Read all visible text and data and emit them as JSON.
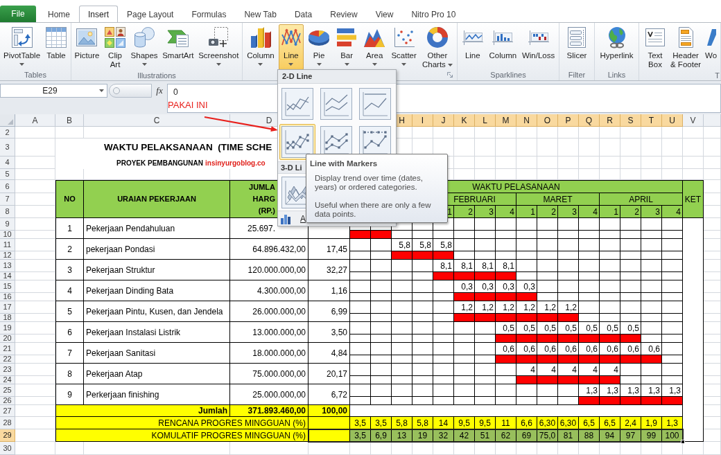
{
  "tabs": {
    "file": "File",
    "items": [
      {
        "label": "Home",
        "selected": false
      },
      {
        "label": "Insert",
        "selected": true
      },
      {
        "label": "Page Layout",
        "selected": false
      },
      {
        "label": "Formulas",
        "selected": false
      },
      {
        "label": "New Tab",
        "selected": false
      },
      {
        "label": "Data",
        "selected": false
      },
      {
        "label": "Review",
        "selected": false
      },
      {
        "label": "View",
        "selected": false
      },
      {
        "label": "Nitro Pro 10",
        "selected": false
      }
    ]
  },
  "ribbon": {
    "groups": [
      {
        "label": "Tables",
        "launcher": false,
        "items": [
          {
            "kind": "pivot",
            "label": [
              "PivotTable"
            ],
            "menu": true
          },
          {
            "kind": "table",
            "label": [
              "Table"
            ],
            "menu": false
          }
        ]
      },
      {
        "label": "Illustrations",
        "launcher": false,
        "items": [
          {
            "kind": "picture",
            "label": [
              "Picture"
            ],
            "menu": false
          },
          {
            "kind": "clipart",
            "label": [
              "Clip",
              "Art"
            ],
            "menu": false
          },
          {
            "kind": "shapes",
            "label": [
              "Shapes"
            ],
            "menu": true
          },
          {
            "kind": "smartart",
            "label": [
              "SmartArt"
            ],
            "menu": false
          },
          {
            "kind": "screenshot",
            "label": [
              "Screenshot"
            ],
            "menu": true
          }
        ]
      },
      {
        "launcher": true,
        "items": [
          {
            "kind": "column",
            "label": [
              "Column"
            ],
            "menu": true,
            "pressed": false
          },
          {
            "kind": "line",
            "label": [
              "Line"
            ],
            "menu": true,
            "pressed": true
          },
          {
            "kind": "pie",
            "label": [
              "Pie"
            ],
            "menu": true,
            "pressed": false
          },
          {
            "kind": "bar",
            "label": [
              "Bar"
            ],
            "menu": true,
            "pressed": false
          },
          {
            "kind": "area",
            "label": [
              "Area"
            ],
            "menu": true,
            "pressed": false
          },
          {
            "kind": "scatter",
            "label": [
              "Scatter"
            ],
            "menu": true,
            "pressed": false
          },
          {
            "kind": "other",
            "label": [
              "Other",
              "Charts"
            ],
            "menu": true,
            "pressed": false
          }
        ]
      },
      {
        "label": "Sparklines",
        "launcher": false,
        "items": [
          {
            "kind": "sparkline",
            "label": [
              "Line"
            ],
            "menu": false
          },
          {
            "kind": "sparkcolumn",
            "label": [
              "Column"
            ],
            "menu": false
          },
          {
            "kind": "winloss",
            "label": [
              "Win/Loss"
            ],
            "menu": false
          }
        ]
      },
      {
        "label": "Filter",
        "launcher": false,
        "items": [
          {
            "kind": "slicer",
            "label": [
              "Slicer"
            ],
            "menu": false
          }
        ]
      },
      {
        "label": "Links",
        "launcher": false,
        "items": [
          {
            "kind": "hyperlink",
            "label": [
              "Hyperlink"
            ],
            "menu": false
          }
        ]
      },
      {
        "label": "T",
        "launcher": false,
        "items": [
          {
            "kind": "textbox",
            "label": [
              "Text",
              "Box"
            ],
            "menu": false
          },
          {
            "kind": "header",
            "label": [
              "Header",
              "& Footer"
            ],
            "menu": false
          },
          {
            "kind": "wordart",
            "label": [
              "Wo"
            ],
            "menu": false
          }
        ]
      }
    ]
  },
  "formula_bar": {
    "name_box": "E29",
    "function_button": "fx",
    "value": "0"
  },
  "annotation": "PAKAI INI",
  "column_headers_left": [
    {
      "label": "A",
      "selected": false
    },
    {
      "label": "B",
      "selected": false
    },
    {
      "label": "C",
      "selected": false
    },
    {
      "label": "D",
      "selected": false
    }
  ],
  "column_headers_right": [
    {
      "label": "H",
      "selected": true
    },
    {
      "label": "I",
      "selected": true
    },
    {
      "label": "J",
      "selected": true
    },
    {
      "label": "K",
      "selected": true
    },
    {
      "label": "L",
      "selected": true
    },
    {
      "label": "M",
      "selected": true
    },
    {
      "label": "N",
      "selected": true
    },
    {
      "label": "O",
      "selected": true
    },
    {
      "label": "P",
      "selected": true
    },
    {
      "label": "Q",
      "selected": true
    },
    {
      "label": "R",
      "selected": true
    },
    {
      "label": "S",
      "selected": true
    },
    {
      "label": "T",
      "selected": true
    },
    {
      "label": "U",
      "selected": true
    },
    {
      "label": "V",
      "selected": false
    }
  ],
  "row_headers": [
    {
      "label": "2",
      "selected": false
    },
    {
      "label": "3",
      "selected": false
    },
    {
      "label": "4",
      "selected": false
    },
    {
      "label": "5",
      "selected": false
    },
    {
      "label": "6",
      "selected": false
    },
    {
      "label": "7",
      "selected": false
    },
    {
      "label": "8",
      "selected": false
    },
    {
      "label": "9",
      "selected": false
    },
    {
      "label": "10",
      "selected": false
    },
    {
      "label": "11",
      "selected": false
    },
    {
      "label": "12",
      "selected": false
    },
    {
      "label": "13",
      "selected": false
    },
    {
      "label": "14",
      "selected": false
    },
    {
      "label": "15",
      "selected": false
    },
    {
      "label": "16",
      "selected": false
    },
    {
      "label": "17",
      "selected": false
    },
    {
      "label": "18",
      "selected": false
    },
    {
      "label": "19",
      "selected": false
    },
    {
      "label": "20",
      "selected": false
    },
    {
      "label": "21",
      "selected": false
    },
    {
      "label": "22",
      "selected": false
    },
    {
      "label": "23",
      "selected": false
    },
    {
      "label": "24",
      "selected": false
    },
    {
      "label": "25",
      "selected": false
    },
    {
      "label": "26",
      "selected": false
    },
    {
      "label": "27",
      "selected": false
    },
    {
      "label": "28",
      "selected": false
    },
    {
      "label": "29",
      "selected": true
    },
    {
      "label": "30",
      "selected": false
    }
  ],
  "sheet": {
    "title": "WAKTU PELAKSANAAN  (TIME SCHE",
    "subtitle": "PROYEK PEMBANGUNAN",
    "website": "insinyurgoblog.co",
    "table": {
      "headers": {
        "no": "NO",
        "description": "URAIAN PEKERJAAN",
        "amount": [
          "JUMLA",
          "HARG",
          "(RP.)"
        ],
        "schedule": "WAKTU PELASANAAN",
        "months": [
          "FEBRUARI",
          "MARET",
          "APRIL"
        ],
        "weeks": [
          "1",
          "2",
          "3",
          "4",
          "1",
          "2",
          "3",
          "4",
          "1",
          "2",
          "3",
          "4"
        ],
        "notes": "KET"
      },
      "rows": [
        {
          "no": "1",
          "description": "Pekerjaan Pendahuluan",
          "amount": "25.697.",
          "weeks": [
            {
              "bar": true
            },
            {
              "bar": true
            },
            {
              "bar": false
            },
            {
              "bar": false
            },
            {
              "bar": false
            },
            {
              "bar": false
            },
            {
              "bar": false
            },
            {
              "bar": false
            },
            {
              "bar": false
            },
            {
              "bar": false
            },
            {
              "bar": false
            },
            {
              "bar": false
            },
            {
              "bar": false
            },
            {
              "bar": false
            },
            {
              "bar": false
            },
            {
              "bar": false
            }
          ]
        },
        {
          "no": "2",
          "description": "pekerjaan Pondasi",
          "amount": "64.896.432,00",
          "weight": "17,45",
          "weeks": [
            {
              "bar": false
            },
            {
              "bar": false
            },
            {
              "value": "5,8",
              "bar": true
            },
            {
              "value": "5,8",
              "bar": true
            },
            {
              "value": "5,8",
              "bar": true
            },
            {
              "bar": false
            },
            {
              "bar": false
            },
            {
              "bar": false
            },
            {
              "bar": false
            },
            {
              "bar": false
            },
            {
              "bar": false
            },
            {
              "bar": false
            },
            {
              "bar": false
            },
            {
              "bar": false
            },
            {
              "bar": false
            },
            {
              "bar": false
            }
          ]
        },
        {
          "no": "3",
          "description": "Pekerjaan Struktur",
          "amount": "120.000.000,00",
          "weight": "32,27",
          "weeks": [
            {
              "bar": false
            },
            {
              "bar": false
            },
            {
              "bar": false
            },
            {
              "bar": false
            },
            {
              "value": "8,1",
              "bar": true
            },
            {
              "value": "8,1",
              "bar": true
            },
            {
              "value": "8,1",
              "bar": true
            },
            {
              "value": "8,1",
              "bar": true
            },
            {
              "bar": false
            },
            {
              "bar": false
            },
            {
              "bar": false
            },
            {
              "bar": false
            },
            {
              "bar": false
            },
            {
              "bar": false
            },
            {
              "bar": false
            },
            {
              "bar": false
            }
          ]
        },
        {
          "no": "4",
          "description": "Pekerjaan Dinding Bata",
          "amount": "4.300.000,00",
          "weight": "1,16",
          "weeks": [
            {
              "bar": false
            },
            {
              "bar": false
            },
            {
              "bar": false
            },
            {
              "bar": false
            },
            {
              "bar": false
            },
            {
              "value": "0,3",
              "bar": true
            },
            {
              "value": "0,3",
              "bar": true
            },
            {
              "value": "0,3",
              "bar": true
            },
            {
              "value": "0,3",
              "bar": true
            },
            {
              "bar": false
            },
            {
              "bar": false
            },
            {
              "bar": false
            },
            {
              "bar": false
            },
            {
              "bar": false
            },
            {
              "bar": false
            },
            {
              "bar": false
            }
          ]
        },
        {
          "no": "5",
          "description": "Pekerjaan Pintu, Kusen, dan Jendela",
          "amount": "26.000.000,00",
          "weight": "6,99",
          "weeks": [
            {
              "bar": false
            },
            {
              "bar": false
            },
            {
              "bar": false
            },
            {
              "bar": false
            },
            {
              "bar": false
            },
            {
              "value": "1,2",
              "bar": true
            },
            {
              "value": "1,2",
              "bar": true
            },
            {
              "value": "1,2",
              "bar": true
            },
            {
              "value": "1,2",
              "bar": true
            },
            {
              "value": "1,2",
              "bar": true
            },
            {
              "value": "1,2",
              "bar": true
            },
            {
              "bar": false
            },
            {
              "bar": false
            },
            {
              "bar": false
            },
            {
              "bar": false
            },
            {
              "bar": false
            }
          ]
        },
        {
          "no": "6",
          "description": "Pekerjaan Instalasi Listrik",
          "amount": "13.000.000,00",
          "weight": "3,50",
          "weeks": [
            {
              "bar": false
            },
            {
              "bar": false
            },
            {
              "bar": false
            },
            {
              "bar": false
            },
            {
              "bar": false
            },
            {
              "bar": false
            },
            {
              "bar": false
            },
            {
              "value": "0,5",
              "bar": true
            },
            {
              "value": "0,5",
              "bar": true
            },
            {
              "value": "0,5",
              "bar": true
            },
            {
              "value": "0,5",
              "bar": true
            },
            {
              "value": "0,5",
              "bar": true
            },
            {
              "value": "0,5",
              "bar": true
            },
            {
              "value": "0,5",
              "bar": true
            },
            {
              "bar": false
            },
            {
              "bar": false
            }
          ]
        },
        {
          "no": "7",
          "description": "Pekerjaan Sanitasi",
          "amount": "18.000.000,00",
          "weight": "4,84",
          "weeks": [
            {
              "bar": false
            },
            {
              "bar": false
            },
            {
              "bar": false
            },
            {
              "bar": false
            },
            {
              "bar": false
            },
            {
              "bar": false
            },
            {
              "bar": false
            },
            {
              "value": "0,6",
              "bar": true
            },
            {
              "value": "0,6",
              "bar": true
            },
            {
              "value": "0,6",
              "bar": true
            },
            {
              "value": "0,6",
              "bar": true
            },
            {
              "value": "0,6",
              "bar": true
            },
            {
              "value": "0,6",
              "bar": true
            },
            {
              "value": "0,6",
              "bar": true
            },
            {
              "value": "0,6",
              "bar": true
            },
            {
              "bar": false
            }
          ]
        },
        {
          "no": "8",
          "description": "Pekerjaan Atap",
          "amount": "75.000.000,00",
          "weight": "20,17",
          "weeks": [
            {
              "bar": false
            },
            {
              "bar": false
            },
            {
              "bar": false
            },
            {
              "bar": false
            },
            {
              "bar": false
            },
            {
              "bar": false
            },
            {
              "bar": false
            },
            {
              "bar": false
            },
            {
              "value": "4",
              "bar": true
            },
            {
              "value": "4",
              "bar": true
            },
            {
              "value": "4",
              "bar": true
            },
            {
              "value": "4",
              "bar": true
            },
            {
              "value": "4",
              "bar": true
            },
            {
              "bar": false
            },
            {
              "bar": false
            },
            {
              "bar": false
            }
          ]
        },
        {
          "no": "9",
          "description": "Perkerjaan finishing",
          "amount": "25.000.000,00",
          "weight": "6,72",
          "weeks": [
            {
              "bar": false
            },
            {
              "bar": false
            },
            {
              "bar": false
            },
            {
              "bar": false
            },
            {
              "bar": false
            },
            {
              "bar": false
            },
            {
              "bar": false
            },
            {
              "bar": false
            },
            {
              "bar": false
            },
            {
              "bar": false
            },
            {
              "bar": false
            },
            {
              "value": "1,3",
              "bar": true
            },
            {
              "value": "1,3",
              "bar": true
            },
            {
              "value": "1,3",
              "bar": true
            },
            {
              "value": "1,3",
              "bar": true
            },
            {
              "value": "1,3",
              "bar": true
            }
          ]
        }
      ],
      "total": {
        "label": "Jumlah",
        "amount": "371.893.460,00",
        "weight": "100,00"
      },
      "plan": {
        "label": "RENCANA PROGRES MINGGUAN (%)",
        "values": [
          "3,5",
          "3,5",
          "5,8",
          "5,8",
          "14",
          "9,5",
          "9,5",
          "11",
          "6,6",
          "6,30",
          "6,30",
          "6,5",
          "6,5",
          "2,4",
          "1,9",
          "1,3"
        ]
      },
      "cumulative": {
        "label": "KOMULATIF PROGRES MINGGUAN (%)",
        "selected": true,
        "values": [
          "3,5",
          "6,9",
          "13",
          "19",
          "32",
          "42",
          "51",
          "62",
          "69",
          "75,0",
          "81",
          "88",
          "94",
          "97",
          "99",
          "100"
        ]
      }
    }
  },
  "chart_menu": {
    "section_2d": "2-D Line",
    "items_2d": [
      {
        "kind": "line",
        "selected": false
      },
      {
        "kind": "stacked",
        "selected": false
      },
      {
        "kind": "percent",
        "selected": false
      },
      {
        "kind": "markers",
        "selected": true
      },
      {
        "kind": "stacked-markers",
        "selected": false
      },
      {
        "kind": "percent-markers",
        "selected": false
      }
    ],
    "section_3d": "3-D Li",
    "items_3d": [
      {
        "kind": "line-3d",
        "selected": false
      }
    ],
    "more": "A"
  },
  "tooltip": {
    "title": "Line with Markers",
    "text": "Display trend over time (dates, years) or ordered categories.",
    "note": "Useful when there are only a few data points."
  }
}
